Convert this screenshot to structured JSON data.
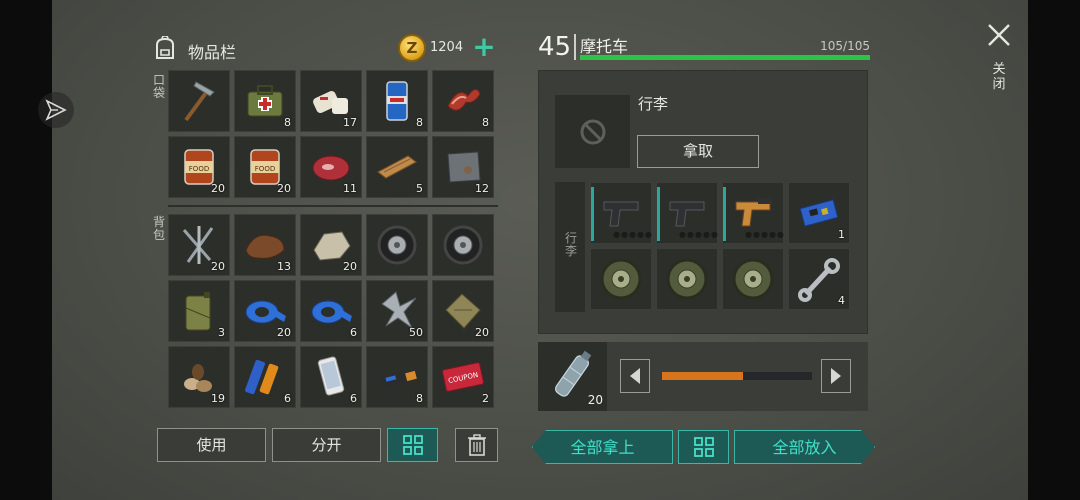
{
  "inventory": {
    "title": "物品栏",
    "coins": "1204",
    "pocket_label": "口袋",
    "backpack_label": "背包",
    "pocket_items": [
      {
        "name": "pickaxe",
        "count": ""
      },
      {
        "name": "medical-bag",
        "count": "8"
      },
      {
        "name": "bandage",
        "count": "17"
      },
      {
        "name": "beer-can",
        "count": "8"
      },
      {
        "name": "bacon",
        "count": "8"
      },
      {
        "name": "canned-food",
        "count": "20"
      },
      {
        "name": "canned-food",
        "count": "20"
      },
      {
        "name": "steak",
        "count": "11"
      },
      {
        "name": "wood-plank",
        "count": "5"
      },
      {
        "name": "metal-plate",
        "count": "12"
      }
    ],
    "backpack_items": [
      {
        "name": "nails",
        "count": "20"
      },
      {
        "name": "leather",
        "count": "13"
      },
      {
        "name": "stone",
        "count": "20"
      },
      {
        "name": "tire",
        "count": ""
      },
      {
        "name": "tire",
        "count": ""
      },
      {
        "name": "jerrycan",
        "count": "3"
      },
      {
        "name": "blue-tape",
        "count": "20"
      },
      {
        "name": "blue-tape",
        "count": "6"
      },
      {
        "name": "scrap-metal",
        "count": "50"
      },
      {
        "name": "cloth",
        "count": "20"
      },
      {
        "name": "seeds",
        "count": "19"
      },
      {
        "name": "battery",
        "count": "6"
      },
      {
        "name": "smartphone",
        "count": "6"
      },
      {
        "name": "usb-stick",
        "count": "8"
      },
      {
        "name": "coupon",
        "count": "2"
      }
    ],
    "use_label": "使用",
    "split_label": "分开"
  },
  "vehicle": {
    "level": "45",
    "name": "摩托车",
    "hp": "105/105",
    "hp_fraction": 1.0
  },
  "trunk": {
    "title": "行李",
    "take_label": "拿取",
    "label": "行李",
    "items": [
      {
        "name": "pistol",
        "count": "",
        "marked": true
      },
      {
        "name": "pistol",
        "count": "",
        "marked": true
      },
      {
        "name": "flare-gun",
        "count": "",
        "marked": true
      },
      {
        "name": "circuit-board",
        "count": "1",
        "marked": false
      },
      {
        "name": "wheel",
        "count": "",
        "marked": false
      },
      {
        "name": "wheel",
        "count": "",
        "marked": false
      },
      {
        "name": "wheel",
        "count": "",
        "marked": false
      },
      {
        "name": "wrench",
        "count": "4",
        "marked": false
      }
    ]
  },
  "fuel": {
    "count": "20",
    "fraction": 0.54
  },
  "actions": {
    "take_all": "全部拿上",
    "put_all": "全部放入"
  },
  "close_label": "关闭"
}
